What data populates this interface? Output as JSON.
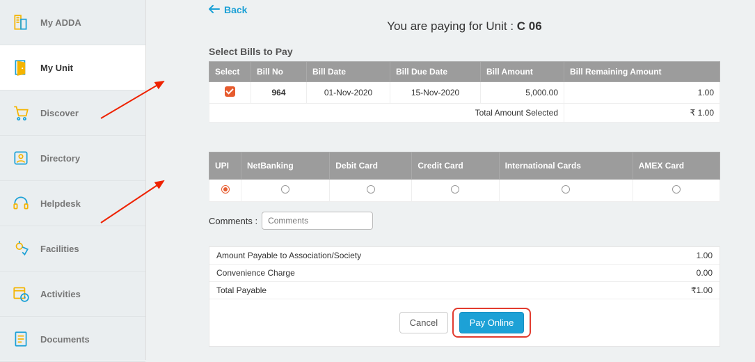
{
  "sidebar": {
    "items": [
      {
        "label": "My ADDA"
      },
      {
        "label": "My Unit"
      },
      {
        "label": "Discover"
      },
      {
        "label": "Directory"
      },
      {
        "label": "Helpdesk"
      },
      {
        "label": "Facilities"
      },
      {
        "label": "Activities"
      },
      {
        "label": "Documents"
      }
    ]
  },
  "back_label": "Back",
  "page_title_prefix": "You are paying for Unit : ",
  "unit": "C 06",
  "bills_section_label": "Select Bills to Pay",
  "bills_headers": [
    "Select",
    "Bill No",
    "Bill Date",
    "Bill Due Date",
    "Bill Amount",
    "Bill Remaining Amount"
  ],
  "bills": [
    {
      "checked": true,
      "no": "964",
      "date": "01-Nov-2020",
      "due": "15-Nov-2020",
      "amount": "5,000.00",
      "remaining": "1.00"
    }
  ],
  "total_selected_label": "Total Amount Selected",
  "total_selected_value": "₹ 1.00",
  "methods": [
    "UPI",
    "NetBanking",
    "Debit Card",
    "Credit Card",
    "International Cards",
    "AMEX Card"
  ],
  "selected_method_index": 0,
  "comments_label": "Comments :",
  "comments_placeholder": "Comments",
  "summary": {
    "rows": [
      {
        "label": "Amount Payable to Association/Society",
        "value": "1.00"
      },
      {
        "label": "Convenience Charge",
        "value": "0.00"
      },
      {
        "label": "Total Payable",
        "value": "₹1.00"
      }
    ]
  },
  "cancel_label": "Cancel",
  "pay_label": "Pay Online"
}
